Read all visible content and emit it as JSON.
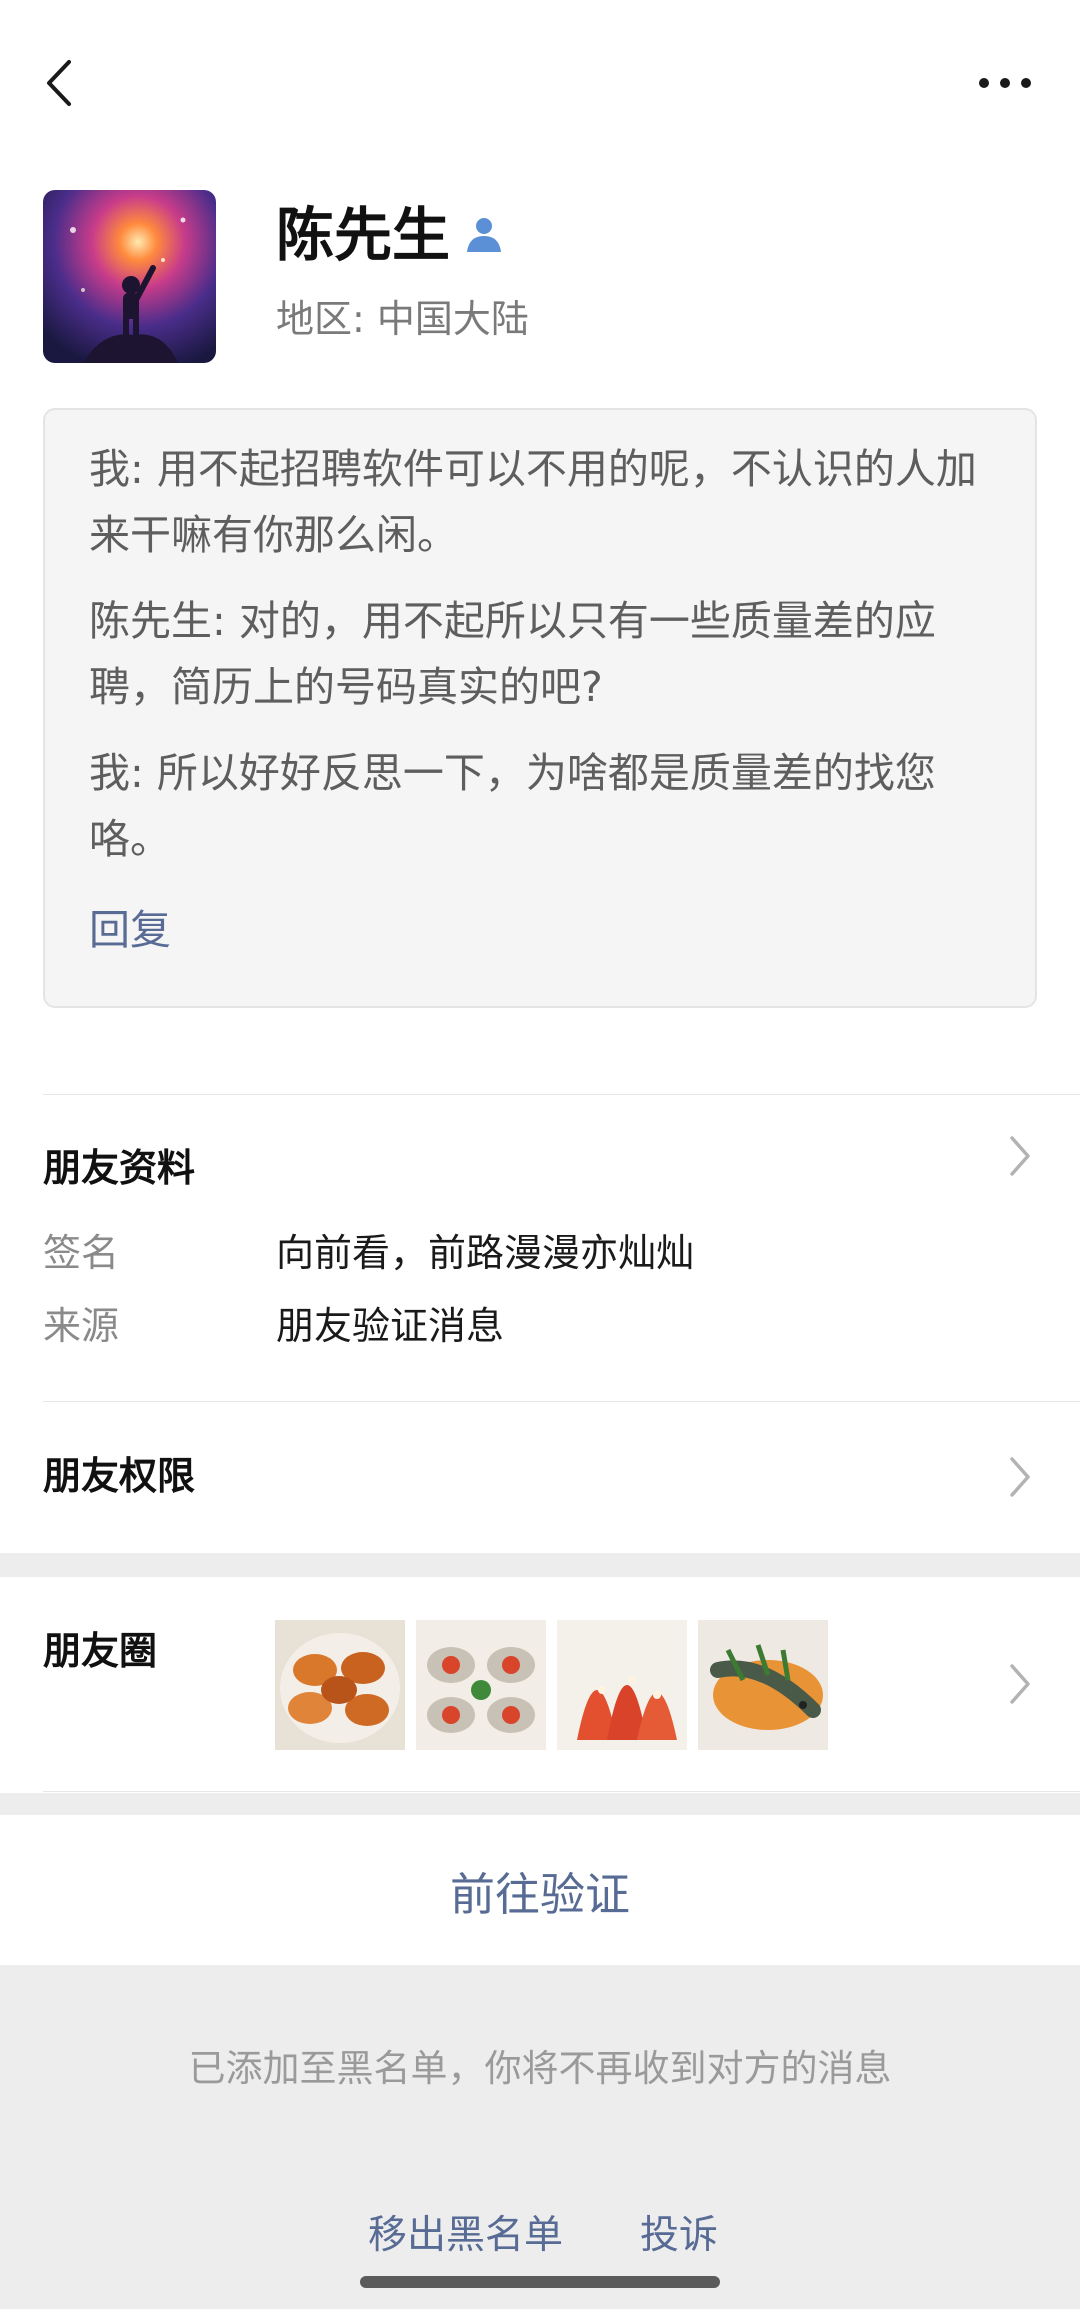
{
  "nav": {
    "back_icon": "chevron-left-icon",
    "more_icon": "more-dots-icon"
  },
  "profile": {
    "name": "陈先生",
    "region": "地区:  中国大陆",
    "badge_icon": "person-icon"
  },
  "messages": {
    "items": [
      "我: 用不起招聘软件可以不用的呢，不认识的人加来干嘛有你那么闲。",
      "陈先生: 对的，用不起所以只有一些质量差的应聘，简历上的号码真实的吧?",
      "我: 所以好好反思一下，为啥都是质量差的找您咯。"
    ],
    "reply_label": "回复"
  },
  "friend_profile": {
    "title": "朋友资料",
    "signature_label": "签名",
    "signature_value": "向前看，前路漫漫亦灿灿",
    "source_label": "来源",
    "source_value": "朋友验证消息"
  },
  "friend_permissions": {
    "title": "朋友权限"
  },
  "moments": {
    "title": "朋友圈",
    "photos": [
      "crab-dish-photo",
      "oyster-dish-photo",
      "shrimp-dish-photo",
      "fish-dish-photo"
    ]
  },
  "verify_button": "前往验证",
  "blacklist": {
    "note": "已添加至黑名单，你将不再收到对方的消息",
    "remove_label": "移出黑名单",
    "report_label": "投诉"
  },
  "colors": {
    "link": "#576b95",
    "background_gray": "#ededed",
    "card_bg": "#f5f5f5"
  }
}
